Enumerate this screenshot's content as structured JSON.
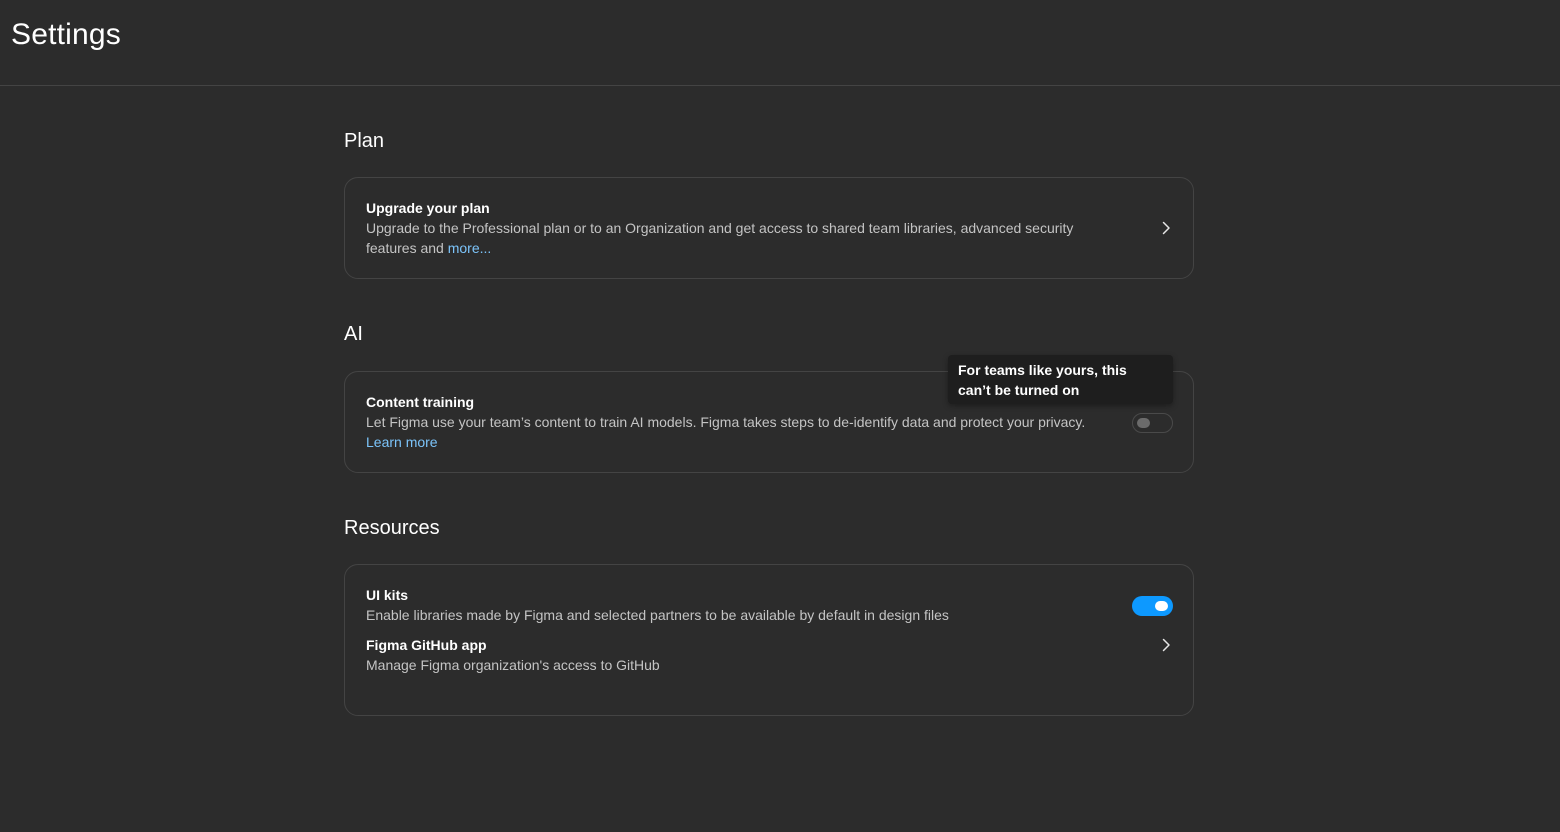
{
  "header": {
    "title": "Settings"
  },
  "plan": {
    "section_title": "Plan",
    "upgrade": {
      "title": "Upgrade your plan",
      "description": "Upgrade to the Professional plan or to an Organization and get access to shared team libraries, advanced security features and ",
      "link": "more..."
    }
  },
  "ai": {
    "section_title": "AI",
    "content_training": {
      "title": "Content training",
      "description": "Let Figma use your team’s content to train AI models. Figma takes steps to de-identify data and protect your privacy. ",
      "link": "Learn more",
      "enabled": false
    },
    "tooltip": "For teams like yours, this can’t be turned on"
  },
  "resources": {
    "section_title": "Resources",
    "ui_kits": {
      "title": "UI kits",
      "description": "Enable libraries made by Figma and selected partners to be available by default in design files",
      "enabled": true
    },
    "github": {
      "title": "Figma GitHub app",
      "description": "Manage Figma organization's access to GitHub"
    }
  },
  "colors": {
    "background": "#2c2c2c",
    "accent": "#0d99ff",
    "link": "#7cc4fa"
  }
}
